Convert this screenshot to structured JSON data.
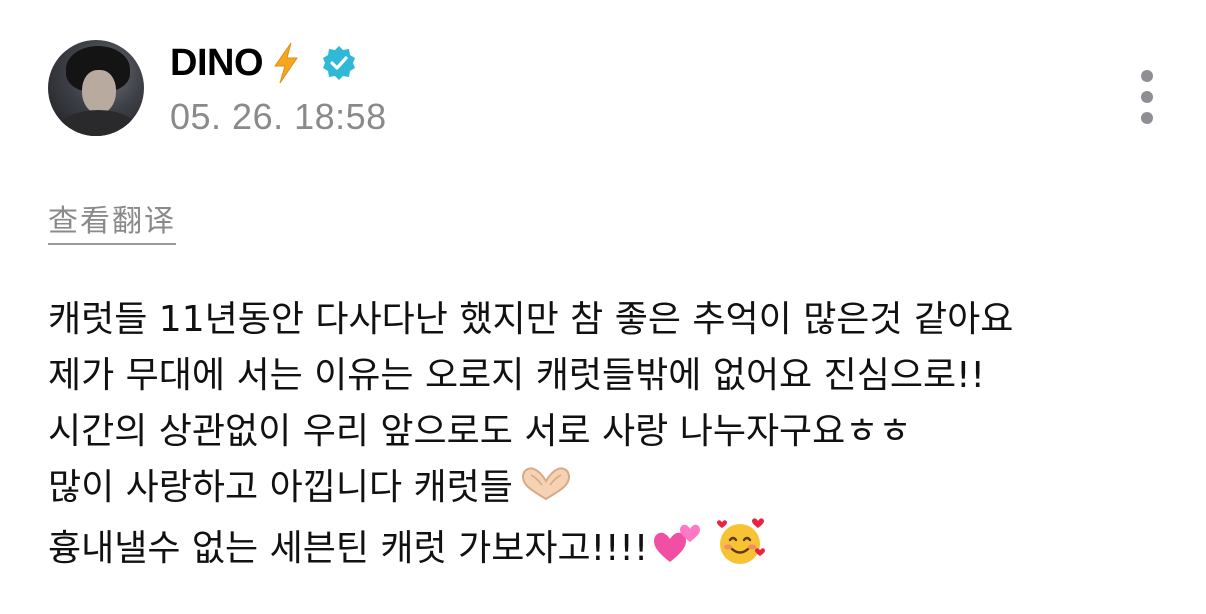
{
  "post": {
    "author": "DINO",
    "timestamp": "05. 26. 18:58",
    "translate_label": "查看翻译",
    "lines": [
      "캐럿들 11년동안 다사다난 했지만 참 좋은 추억이 많은것 같아요",
      "제가 무대에 서는 이유는 오로지 캐럿들밖에 없어요 진심으로!!",
      "시간의 상관없이 우리 앞으로도 서로 사랑 나누자구요ㅎㅎ",
      "많이 사랑하고 아낍니다 캐럿들",
      "흉내낼수 없는 세븐틴 캐럿 가보자고!!!!"
    ],
    "icons": {
      "name_emoji": "lightning-icon",
      "verified": "verified-badge-icon",
      "more": "more-vertical-icon",
      "line4_emoji": "heart-hands-icon",
      "line5_emoji1": "two-hearts-icon",
      "line5_emoji2": "smiling-face-with-hearts-icon"
    },
    "colors": {
      "verified_badge": "#2fb9d6",
      "lightning": "#f5a623",
      "secondary_text": "#8a8a8a",
      "primary_text": "#111111"
    }
  }
}
